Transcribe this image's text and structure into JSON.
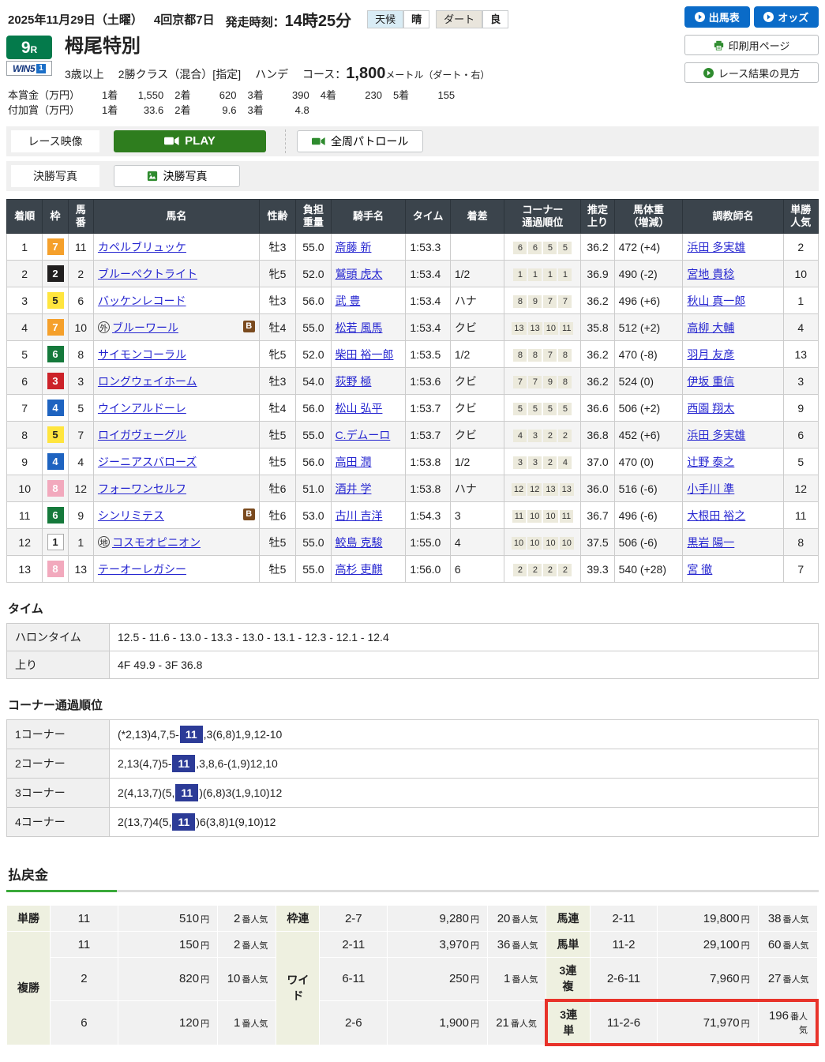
{
  "header": {
    "date": "2025年11月29日（土曜）",
    "meeting": "4回京都7日",
    "start_label": "発走時刻：",
    "start_time": "14時25分",
    "weather_label": "天候",
    "weather_value": "晴",
    "surface_label": "ダート",
    "surface_value": "良",
    "entries_button": "出馬表",
    "odds_button": "オッズ",
    "print_button": "印刷用ページ",
    "guide_button": "レース結果の見方"
  },
  "race": {
    "number": "9",
    "number_suffix": "R",
    "win5_text": "WIN5",
    "win5_num": "1",
    "title": "栂尾特別",
    "cond1": "3歳以上",
    "cond2": "2勝クラス（混合）[指定]",
    "cond3": "ハンデ",
    "course_label": "コース：",
    "course_distance": "1,800",
    "course_suffix": "メートル（ダート・右）"
  },
  "prize": {
    "main_label": "本賞金（万円）",
    "main": [
      {
        "rank": "1着",
        "value": "1,550"
      },
      {
        "rank": "2着",
        "value": "620"
      },
      {
        "rank": "3着",
        "value": "390"
      },
      {
        "rank": "4着",
        "value": "230"
      },
      {
        "rank": "5着",
        "value": "155"
      }
    ],
    "added_label": "付加賞（万円）",
    "added": [
      {
        "rank": "1着",
        "value": "33.6"
      },
      {
        "rank": "2着",
        "value": "9.6"
      },
      {
        "rank": "3着",
        "value": "4.8"
      }
    ]
  },
  "media": {
    "video_label": "レース映像",
    "play_button": "PLAY",
    "patrol_button": "全周パトロール",
    "photo_label": "決勝写真",
    "photo_button": "決勝写真"
  },
  "results": {
    "headers": [
      "着順",
      "枠",
      "馬\n番",
      "馬名",
      "性齢",
      "負担\n重量",
      "騎手名",
      "タイム",
      "着差",
      "コーナー\n通過順位",
      "推定\n上り",
      "馬体重\n（増減）",
      "調教師名",
      "単勝\n人気"
    ],
    "rows": [
      {
        "pos": "1",
        "frame": "7",
        "num": "11",
        "mark": "",
        "blinkers": false,
        "horse": "カペルブリュッケ",
        "sex_age": "牡3",
        "weight": "55.0",
        "jockey": "斎藤 新",
        "time": "1:53.3",
        "margin": "",
        "corners": [
          "6",
          "6",
          "5",
          "5"
        ],
        "last3f": "36.2",
        "body": "472 (+4)",
        "trainer": "浜田 多実雄",
        "pop": "2"
      },
      {
        "pos": "2",
        "frame": "2",
        "num": "2",
        "mark": "",
        "blinkers": false,
        "horse": "ブルーペクトライト",
        "sex_age": "牝5",
        "weight": "52.0",
        "jockey": "鷲頭 虎太",
        "time": "1:53.4",
        "margin": "1/2",
        "corners": [
          "1",
          "1",
          "1",
          "1"
        ],
        "last3f": "36.9",
        "body": "490 (-2)",
        "trainer": "宮地 貴稔",
        "pop": "10"
      },
      {
        "pos": "3",
        "frame": "5",
        "num": "6",
        "mark": "",
        "blinkers": false,
        "horse": "バッケンレコード",
        "sex_age": "牡3",
        "weight": "56.0",
        "jockey": "武 豊",
        "time": "1:53.4",
        "margin": "ハナ",
        "corners": [
          "8",
          "9",
          "7",
          "7"
        ],
        "last3f": "36.2",
        "body": "496 (+6)",
        "trainer": "秋山 真一郎",
        "pop": "1"
      },
      {
        "pos": "4",
        "frame": "7",
        "num": "10",
        "mark": "外",
        "blinkers": true,
        "horse": "ブルーワール",
        "sex_age": "牡4",
        "weight": "55.0",
        "jockey": "松若 風馬",
        "time": "1:53.4",
        "margin": "クビ",
        "corners": [
          "13",
          "13",
          "10",
          "11"
        ],
        "last3f": "35.8",
        "body": "512 (+2)",
        "trainer": "高柳 大輔",
        "pop": "4"
      },
      {
        "pos": "5",
        "frame": "6",
        "num": "8",
        "mark": "",
        "blinkers": false,
        "horse": "サイモンコーラル",
        "sex_age": "牝5",
        "weight": "52.0",
        "jockey": "柴田 裕一郎",
        "time": "1:53.5",
        "margin": "1/2",
        "corners": [
          "8",
          "8",
          "7",
          "8"
        ],
        "last3f": "36.2",
        "body": "470 (-8)",
        "trainer": "羽月 友彦",
        "pop": "13"
      },
      {
        "pos": "6",
        "frame": "3",
        "num": "3",
        "mark": "",
        "blinkers": false,
        "horse": "ロングウェイホーム",
        "sex_age": "牡3",
        "weight": "54.0",
        "jockey": "荻野 極",
        "time": "1:53.6",
        "margin": "クビ",
        "corners": [
          "7",
          "7",
          "9",
          "8"
        ],
        "last3f": "36.2",
        "body": "524 (0)",
        "trainer": "伊坂 重信",
        "pop": "3"
      },
      {
        "pos": "7",
        "frame": "4",
        "num": "5",
        "mark": "",
        "blinkers": false,
        "horse": "ウインアルドーレ",
        "sex_age": "牡4",
        "weight": "56.0",
        "jockey": "松山 弘平",
        "time": "1:53.7",
        "margin": "クビ",
        "corners": [
          "5",
          "5",
          "5",
          "5"
        ],
        "last3f": "36.6",
        "body": "506 (+2)",
        "trainer": "西園 翔太",
        "pop": "9"
      },
      {
        "pos": "8",
        "frame": "5",
        "num": "7",
        "mark": "",
        "blinkers": false,
        "horse": "ロイガヴェーグル",
        "sex_age": "牡5",
        "weight": "55.0",
        "jockey": "C.デムーロ",
        "time": "1:53.7",
        "margin": "クビ",
        "corners": [
          "4",
          "3",
          "2",
          "2"
        ],
        "last3f": "36.8",
        "body": "452 (+6)",
        "trainer": "浜田 多実雄",
        "pop": "6"
      },
      {
        "pos": "9",
        "frame": "4",
        "num": "4",
        "mark": "",
        "blinkers": false,
        "horse": "ジーニアスバローズ",
        "sex_age": "牡5",
        "weight": "56.0",
        "jockey": "高田 潤",
        "time": "1:53.8",
        "margin": "1/2",
        "corners": [
          "3",
          "3",
          "2",
          "4"
        ],
        "last3f": "37.0",
        "body": "470 (0)",
        "trainer": "辻野 泰之",
        "pop": "5"
      },
      {
        "pos": "10",
        "frame": "8",
        "num": "12",
        "mark": "",
        "blinkers": false,
        "horse": "フォーワンセルフ",
        "sex_age": "牡6",
        "weight": "51.0",
        "jockey": "酒井 学",
        "time": "1:53.8",
        "margin": "ハナ",
        "corners": [
          "12",
          "12",
          "13",
          "13"
        ],
        "last3f": "36.0",
        "body": "516 (-6)",
        "trainer": "小手川 準",
        "pop": "12"
      },
      {
        "pos": "11",
        "frame": "6",
        "num": "9",
        "mark": "",
        "blinkers": true,
        "horse": "シンリミテス",
        "sex_age": "牡6",
        "weight": "53.0",
        "jockey": "古川 吉洋",
        "time": "1:54.3",
        "margin": "3",
        "corners": [
          "11",
          "10",
          "10",
          "11"
        ],
        "last3f": "36.7",
        "body": "496 (-6)",
        "trainer": "大根田 裕之",
        "pop": "11"
      },
      {
        "pos": "12",
        "frame": "1",
        "num": "1",
        "mark": "地",
        "blinkers": false,
        "horse": "コスモオピニオン",
        "sex_age": "牡5",
        "weight": "55.0",
        "jockey": "鮫島 克駿",
        "time": "1:55.0",
        "margin": "4",
        "corners": [
          "10",
          "10",
          "10",
          "10"
        ],
        "last3f": "37.5",
        "body": "506 (-6)",
        "trainer": "黒岩 陽一",
        "pop": "8"
      },
      {
        "pos": "13",
        "frame": "8",
        "num": "13",
        "mark": "",
        "blinkers": false,
        "horse": "テーオーレガシー",
        "sex_age": "牡5",
        "weight": "55.0",
        "jockey": "高杉 吏麒",
        "time": "1:56.0",
        "margin": "6",
        "corners": [
          "2",
          "2",
          "2",
          "2"
        ],
        "last3f": "39.3",
        "body": "540 (+28)",
        "trainer": "宮 徹",
        "pop": "7"
      }
    ]
  },
  "time_section": {
    "title": "タイム",
    "rows": [
      {
        "label": "ハロンタイム",
        "value": "12.5 - 11.6 - 13.0 - 13.3 - 13.0 - 13.1 - 12.3 - 12.1 - 12.4"
      },
      {
        "label": "上り",
        "value": "4F 49.9 - 3F 36.8"
      }
    ]
  },
  "corner_section": {
    "title": "コーナー通過順位",
    "rows": [
      {
        "label": "1コーナー",
        "before": "(*2,13)4,7,5-",
        "hl": "11",
        "after": ",3(6,8)1,9,12-10"
      },
      {
        "label": "2コーナー",
        "before": "2,13(4,7)5-",
        "hl": "11",
        "after": ",3,8,6-(1,9)12,10"
      },
      {
        "label": "3コーナー",
        "before": "2(4,13,7)(5,",
        "hl": "11",
        "after": ")(6,8)3(1,9,10)12"
      },
      {
        "label": "4コーナー",
        "before": "2(13,7)4(5,",
        "hl": "11",
        "after": ")6(3,8)1(9,10)12"
      }
    ]
  },
  "payout": {
    "title": "払戻金",
    "currency_suffix": "円",
    "pop_suffix": "番人気",
    "rows": [
      [
        {
          "type": "label",
          "text": "単勝"
        },
        {
          "type": "combo",
          "text": "11"
        },
        {
          "type": "amount",
          "text": "510"
        },
        {
          "type": "pop",
          "text": "2"
        },
        {
          "type": "label",
          "text": "枠連"
        },
        {
          "type": "combo",
          "text": "2-7"
        },
        {
          "type": "amount",
          "text": "9,280"
        },
        {
          "type": "pop",
          "text": "20"
        },
        {
          "type": "label",
          "text": "馬連"
        },
        {
          "type": "combo",
          "text": "2-11"
        },
        {
          "type": "amount",
          "text": "19,800"
        },
        {
          "type": "pop",
          "text": "38"
        }
      ],
      [
        {
          "type": "label",
          "text": "複勝",
          "rowspan": 3
        },
        {
          "type": "combo",
          "text": "11"
        },
        {
          "type": "amount",
          "text": "150"
        },
        {
          "type": "pop",
          "text": "2"
        },
        {
          "type": "label",
          "text": "ワイド",
          "rowspan": 3
        },
        {
          "type": "combo",
          "text": "2-11"
        },
        {
          "type": "amount",
          "text": "3,970"
        },
        {
          "type": "pop",
          "text": "36"
        },
        {
          "type": "label",
          "text": "馬単"
        },
        {
          "type": "combo",
          "text": "11-2"
        },
        {
          "type": "amount",
          "text": "29,100"
        },
        {
          "type": "pop",
          "text": "60"
        }
      ],
      [
        {
          "type": "combo",
          "text": "2",
          "dash": true
        },
        {
          "type": "amount",
          "text": "820",
          "dash": true
        },
        {
          "type": "pop",
          "text": "10",
          "dash": true
        },
        {
          "type": "combo",
          "text": "6-11",
          "dash": true
        },
        {
          "type": "amount",
          "text": "250",
          "dash": true
        },
        {
          "type": "pop",
          "text": "1",
          "dash": true
        },
        {
          "type": "label",
          "text": "3連複"
        },
        {
          "type": "combo",
          "text": "2-6-11"
        },
        {
          "type": "amount",
          "text": "7,960"
        },
        {
          "type": "pop",
          "text": "27"
        }
      ],
      [
        {
          "type": "combo",
          "text": "6",
          "dash": true
        },
        {
          "type": "amount",
          "text": "120",
          "dash": true
        },
        {
          "type": "pop",
          "text": "1",
          "dash": true
        },
        {
          "type": "combo",
          "text": "2-6",
          "dash": true
        },
        {
          "type": "amount",
          "text": "1,900",
          "dash": true
        },
        {
          "type": "pop",
          "text": "21",
          "dash": true
        },
        {
          "type": "label",
          "text": "3連単",
          "hl": "first"
        },
        {
          "type": "combo",
          "text": "11-2-6",
          "hl": "mid"
        },
        {
          "type": "amount",
          "text": "71,970",
          "hl": "mid"
        },
        {
          "type": "pop",
          "text": "196",
          "hl": "last"
        }
      ]
    ]
  }
}
